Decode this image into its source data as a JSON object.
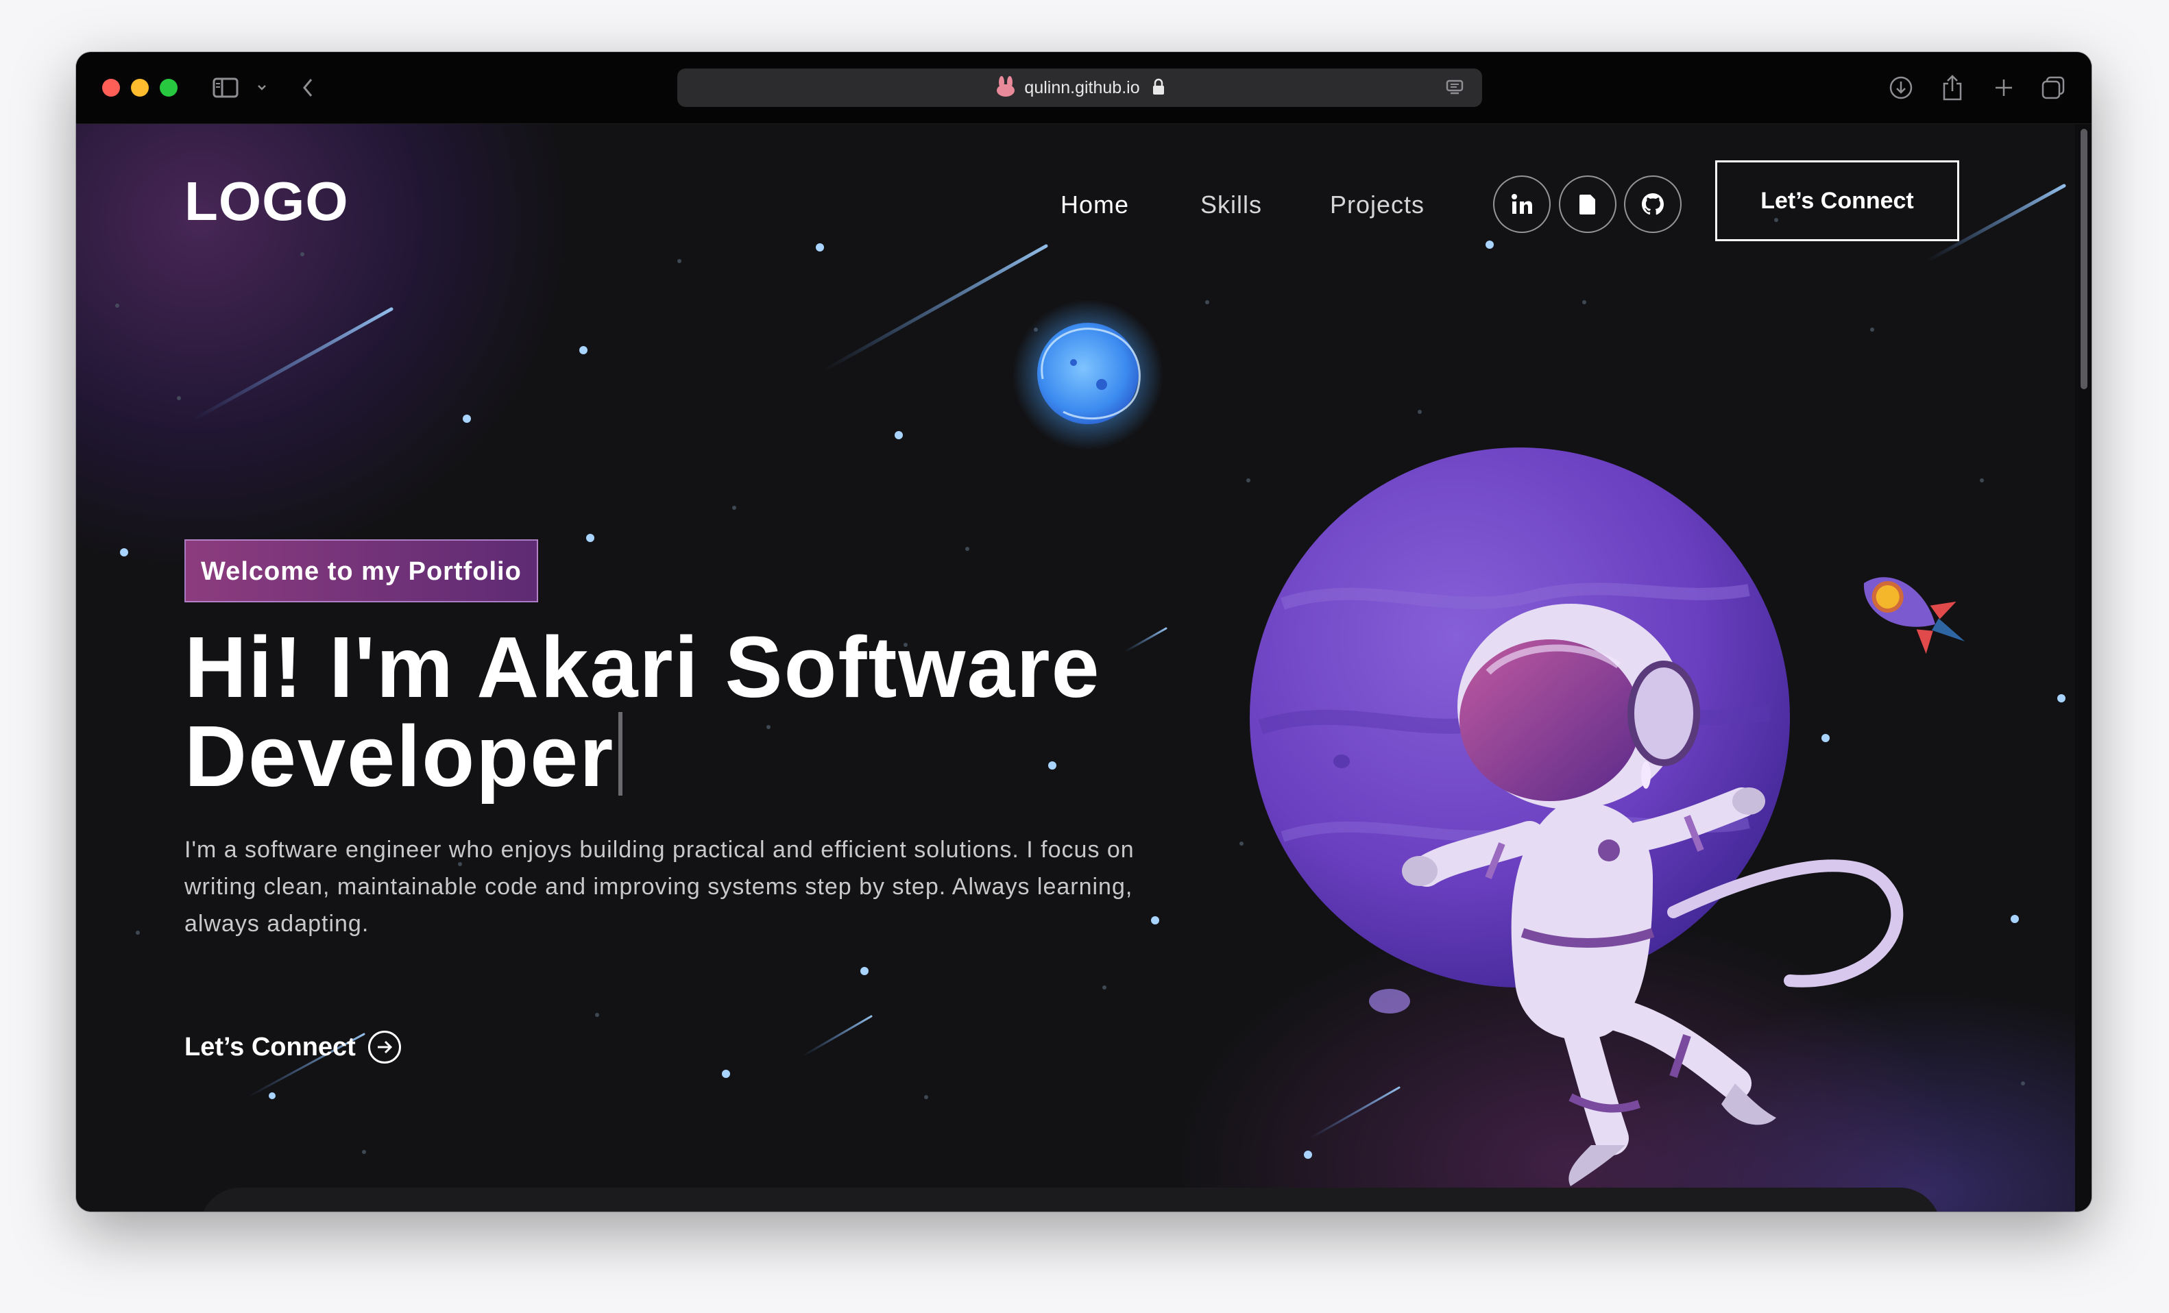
{
  "browser": {
    "domain": "qulinn.github.io",
    "icons": [
      "sidebar-toggle-icon",
      "chevron-down-icon",
      "back-arrow-icon",
      "lock-icon",
      "reader-icon",
      "download-icon",
      "share-icon",
      "new-tab-icon",
      "tab-overview-icon"
    ]
  },
  "header": {
    "logo": "LOGO",
    "nav": [
      {
        "label": "Home"
      },
      {
        "label": "Skills"
      },
      {
        "label": "Projects"
      }
    ],
    "social_icons": [
      "linkedin-icon",
      "document-icon",
      "github-icon"
    ],
    "connect_button": "Let’s Connect"
  },
  "hero": {
    "tagline": "Welcome to my Portfolio",
    "headline_line1": "Hi! I'm Akari Software",
    "headline_line2": "Developer",
    "description": "I'm a software engineer who enjoys building practical and efficient solutions. I focus on writing clean, maintainable code and improving systems step by step. Always learning, always adapting.",
    "cta": "Let’s Connect"
  },
  "colors": {
    "background": "#121214",
    "accent_purple": "#6a3fb8",
    "tagline_gradient_start": "#8c3c7e",
    "tagline_gradient_end": "#5e2b74",
    "text": "#ffffff"
  }
}
